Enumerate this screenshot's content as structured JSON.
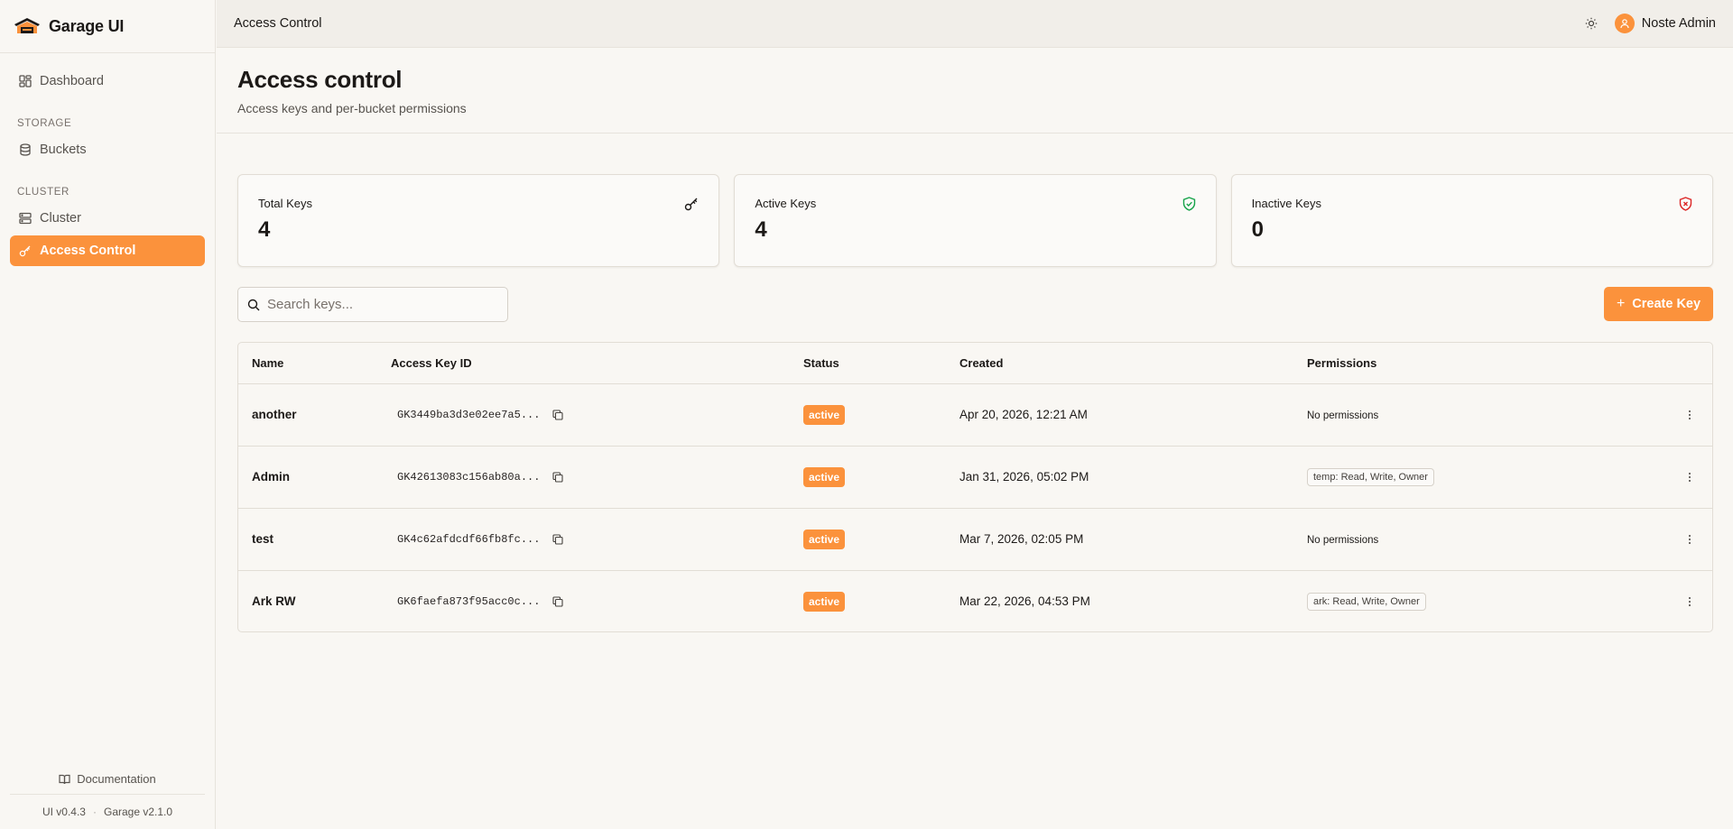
{
  "app": {
    "name": "Garage UI"
  },
  "colors": {
    "accent": "#fb923c",
    "success": "#16a34a",
    "danger": "#dc2626",
    "background": "#f9f7f3"
  },
  "sidebar": {
    "items": [
      {
        "label": "Dashboard",
        "icon": "dashboard-icon"
      }
    ],
    "sections": [
      {
        "title": "STORAGE",
        "items": [
          {
            "label": "Buckets",
            "icon": "database-icon"
          }
        ]
      },
      {
        "title": "CLUSTER",
        "items": [
          {
            "label": "Cluster",
            "icon": "server-icon"
          },
          {
            "label": "Access Control",
            "icon": "key-icon",
            "active": true
          }
        ]
      }
    ],
    "footer": {
      "documentation_label": "Documentation",
      "ui_version": "UI v0.4.3",
      "garage_version": "Garage v2.1.0"
    }
  },
  "topbar": {
    "breadcrumb": "Access Control",
    "user_name": "Noste Admin"
  },
  "page": {
    "title": "Access control",
    "subtitle": "Access keys and per-bucket permissions"
  },
  "stats": [
    {
      "label": "Total Keys",
      "value": "4",
      "icon": "key-icon"
    },
    {
      "label": "Active Keys",
      "value": "4",
      "icon": "shield-check-icon"
    },
    {
      "label": "Inactive Keys",
      "value": "0",
      "icon": "shield-x-icon"
    }
  ],
  "search": {
    "placeholder": "Search keys..."
  },
  "create_button_label": "Create Key",
  "table": {
    "columns": [
      "Name",
      "Access Key ID",
      "Status",
      "Created",
      "Permissions"
    ],
    "rows": [
      {
        "name": "another",
        "key_id": "GK3449ba3d3e02ee7a5...",
        "status": "active",
        "created": "Apr 20, 2026, 12:21 AM",
        "permissions": "No permissions",
        "has_permissions": false
      },
      {
        "name": "Admin",
        "key_id": "GK42613083c156ab80a...",
        "status": "active",
        "created": "Jan 31, 2026, 05:02 PM",
        "permissions": "temp: Read, Write, Owner",
        "has_permissions": true
      },
      {
        "name": "test",
        "key_id": "GK4c62afdcdf66fb8fc...",
        "status": "active",
        "created": "Mar 7, 2026, 02:05 PM",
        "permissions": "No permissions",
        "has_permissions": false
      },
      {
        "name": "Ark RW",
        "key_id": "GK6faefa873f95acc0c...",
        "status": "active",
        "created": "Mar 22, 2026, 04:53 PM",
        "permissions": "ark: Read, Write, Owner",
        "has_permissions": true
      }
    ]
  }
}
